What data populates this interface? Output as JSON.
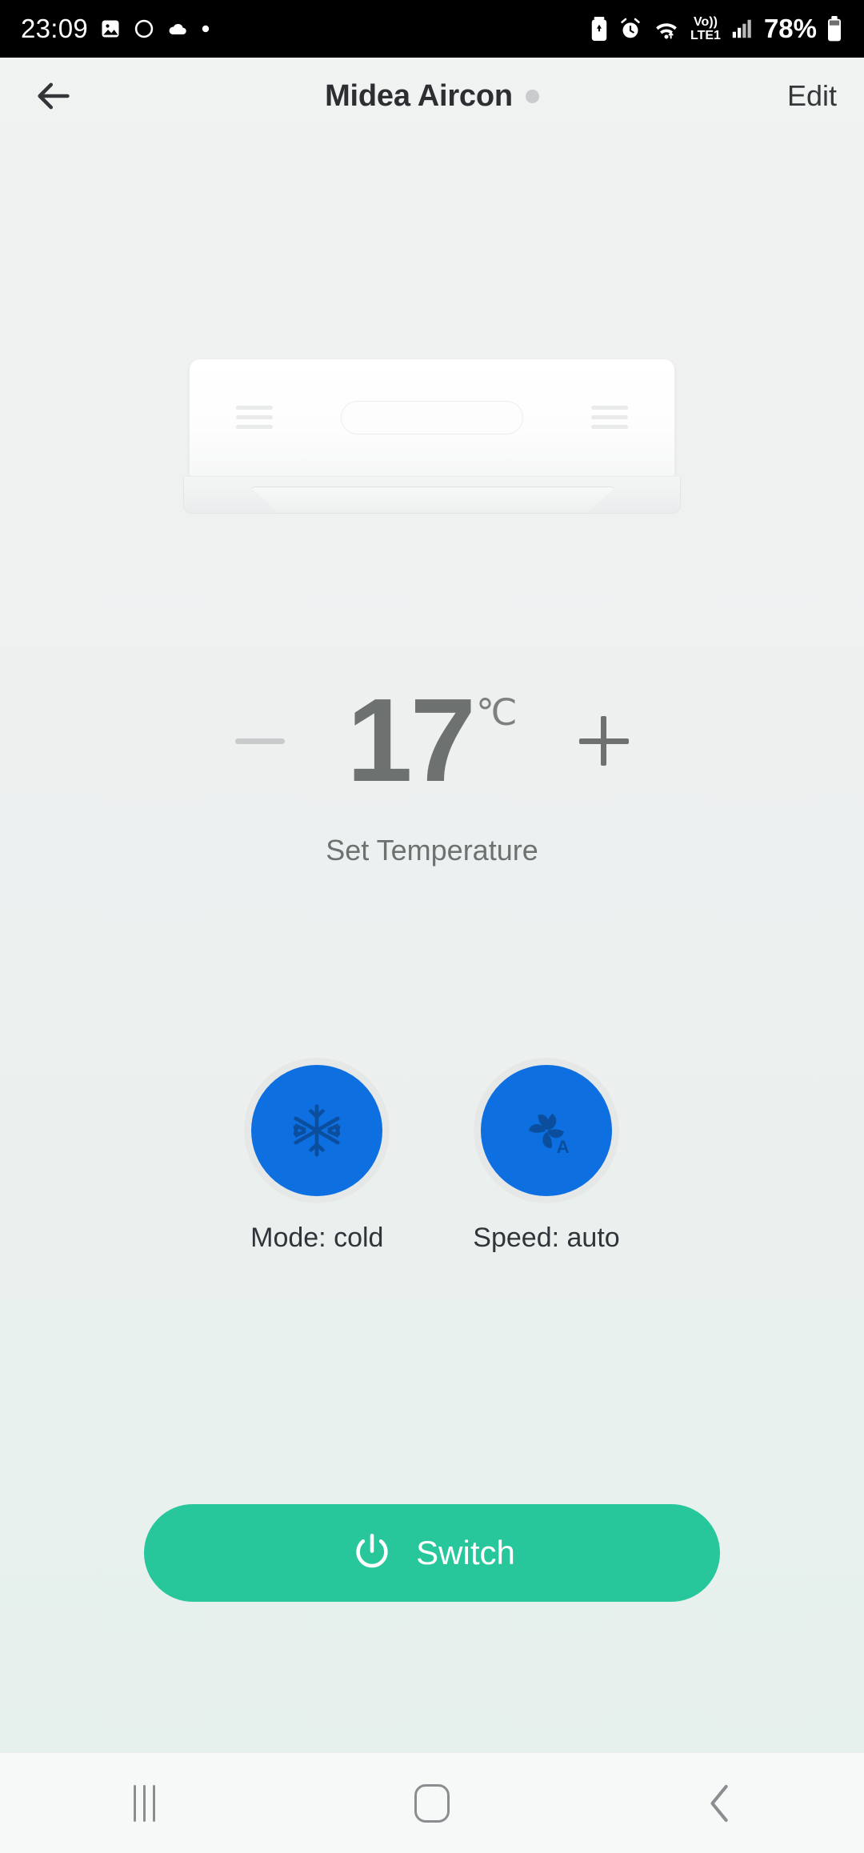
{
  "statusbar": {
    "time": "23:09",
    "left_icons": [
      "image-icon",
      "circle-outline-icon",
      "cloud-icon",
      "dot-icon"
    ],
    "right_icons": [
      "battery-saver-icon",
      "alarm-icon",
      "wifi-icon",
      "volte-icon",
      "signal-icon"
    ],
    "volte_top": "Vo))",
    "volte_bottom": "LTE1",
    "battery_percent": "78%"
  },
  "header": {
    "back_icon": "arrow-left-icon",
    "title": "Midea Aircon",
    "status_dot_color": "#c9ccce",
    "edit_label": "Edit"
  },
  "device": {
    "image_name": "air-conditioner-illustration"
  },
  "temperature": {
    "decrease_label": "−",
    "value": "17",
    "unit": "℃",
    "increase_label": "+",
    "caption": "Set Temperature",
    "decrease_enabled": false,
    "increase_enabled": true
  },
  "controls": [
    {
      "icon": "snowflake-icon",
      "label": "Mode: cold",
      "color": "#0d6fe0",
      "ring_color": "#e6e8e7"
    },
    {
      "icon": "fan-auto-icon",
      "label": "Speed: auto",
      "color": "#0d6fe0",
      "ring_color": "#e6e8e7"
    }
  ],
  "switch": {
    "icon": "power-icon",
    "label": "Switch",
    "color": "#27c79b"
  },
  "navbar": {
    "recents": "recents-icon",
    "home": "home-icon",
    "back": "back-chevron-icon"
  }
}
